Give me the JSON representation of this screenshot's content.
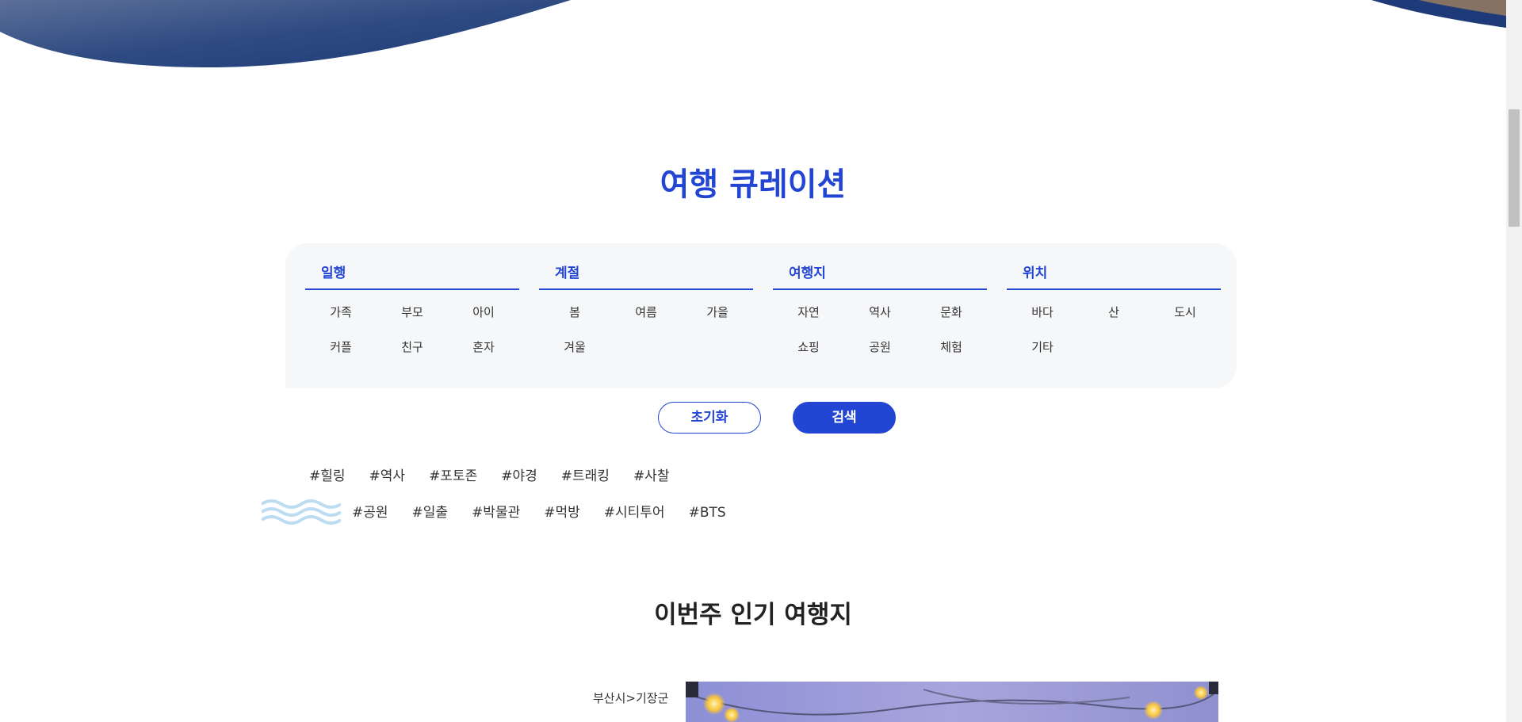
{
  "curation": {
    "title": "여행 큐레이션",
    "groups": [
      {
        "title": "일행",
        "options": [
          "가족",
          "부모",
          "아이",
          "커플",
          "친구",
          "혼자"
        ]
      },
      {
        "title": "계절",
        "options": [
          "봄",
          "여름",
          "가을",
          "겨울"
        ]
      },
      {
        "title": "여행지",
        "options": [
          "자연",
          "역사",
          "문화",
          "쇼핑",
          "공원",
          "체험"
        ]
      },
      {
        "title": "위치",
        "options": [
          "바다",
          "산",
          "도시",
          "기타"
        ]
      }
    ],
    "reset_label": "초기화",
    "search_label": "검색"
  },
  "hashtags": {
    "row1": [
      "#힐링",
      "#역사",
      "#포토존",
      "#야경",
      "#트래킹",
      "#사찰"
    ],
    "row2": [
      "#공원",
      "#일출",
      "#박물관",
      "#먹방",
      "#시티투어",
      "#BTS"
    ]
  },
  "popular": {
    "title": "이번주 인기 여행지",
    "location": "부산시>기장군"
  },
  "colors": {
    "accent": "#2245d4",
    "panel_bg": "#f6f7f9"
  }
}
